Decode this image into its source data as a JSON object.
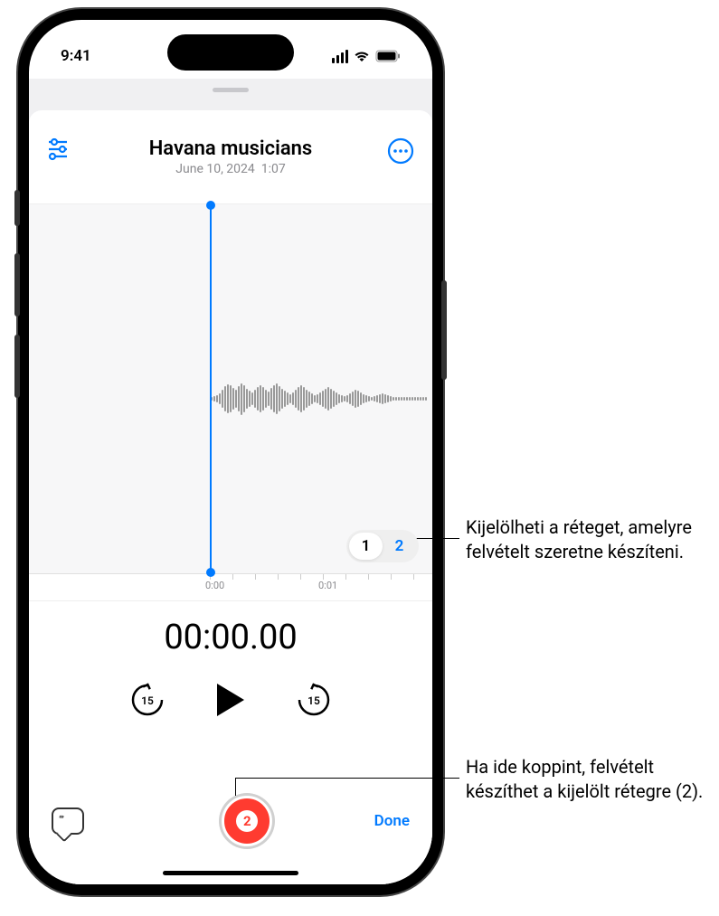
{
  "status": {
    "time": "9:41"
  },
  "header": {
    "title": "Havana musicians",
    "date": "June 10, 2024",
    "duration": "1:07"
  },
  "waveform": {
    "ruler": {
      "t0": "0:00",
      "t1": "0:01"
    }
  },
  "layer_selector": {
    "option1": "1",
    "option2": "2"
  },
  "timer": "00:00.00",
  "record_badge": "2",
  "done_label": "Done",
  "callouts": {
    "c1": "Kijelölheti a réteget, amelyre felvételt szeretne készíteni.",
    "c2": "Ha ide koppint, felvételt készíthet a kijelölt rétegre (2)."
  }
}
